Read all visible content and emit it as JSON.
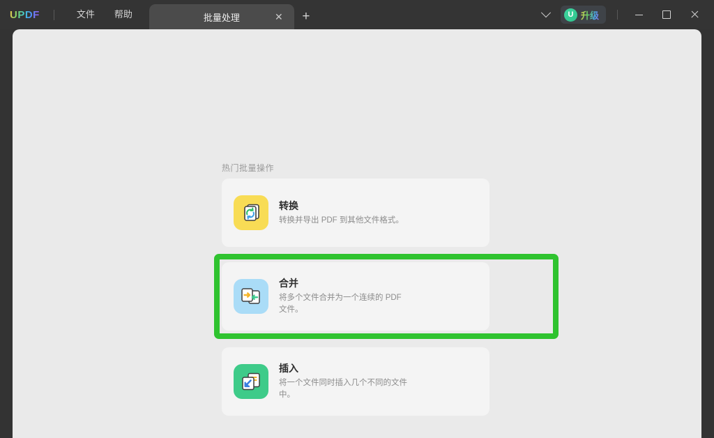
{
  "window": {
    "logo": "UPDF",
    "menus": [
      {
        "name": "file-menu",
        "label": "文件"
      },
      {
        "name": "help-menu",
        "label": "帮助"
      }
    ],
    "tabs": [
      {
        "name": "tab-batch-process",
        "label": "批量处理",
        "close": "✕",
        "active": true
      }
    ],
    "new_tab": "+",
    "upgrade": {
      "avatar": "U",
      "label": "升级"
    },
    "controls": {
      "chevron": "chevron-down-icon",
      "minimize": "minimize-icon",
      "maximize": "maximize-icon",
      "close": "close-icon"
    }
  },
  "main": {
    "section_title": "热门批量操作",
    "cards": [
      {
        "name": "batch-card-convert",
        "icon": "convert-icon",
        "icon_color": "#f8dc55",
        "title": "转换",
        "desc": "转换并导出 PDF 到其他文件格式。",
        "selected": false
      },
      {
        "name": "batch-card-merge",
        "icon": "merge-icon",
        "icon_color": "#aadcf7",
        "title": "合并",
        "desc": "将多个文件合并为一个连续的 PDF 文件。",
        "selected": true
      },
      {
        "name": "batch-card-insert",
        "icon": "insert-icon",
        "icon_color": "#3ecb89",
        "title": "插入",
        "desc": "将一个文件同时插入几个不同的文件中。",
        "selected": false
      }
    ],
    "highlight_color": "#2fc32f"
  }
}
